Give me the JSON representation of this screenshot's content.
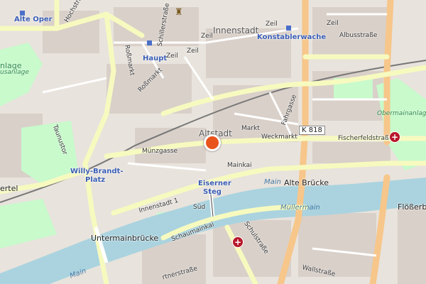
{
  "map": {
    "districts": {
      "innenstadt": "Innenstadt",
      "altstadt": "Altstadt"
    },
    "stations": {
      "alte_oper": "Alte Oper",
      "konstablerwache": "Konstablerwache",
      "haupt": "Haupt",
      "willy_line1": "Willy-Brandt-",
      "willy_line2": "Platz",
      "eiserner_line1": "Eiserner",
      "eiserner_line2": "Steg"
    },
    "streets": {
      "zeil1": "Zeil",
      "zeil2": "Zeil",
      "zeil3": "Zeil",
      "zeil4": "Zeil",
      "zeil5": "Zeil",
      "albusstrasse": "Albusstraße",
      "schillerstrasse": "Schillerstraße",
      "rossmarkt1": "Roßmarkt",
      "rossmarkt2": "Roßmarkt",
      "taunustor": "Taunustor",
      "munzgasse": "Münzgasse",
      "mainkai": "Mainkai",
      "markt": "Markt",
      "weckmarkt": "Weckmarkt",
      "fahrgasse": "Fahrgasse",
      "fischerfeldstrasse": "Fischerfeldstraße",
      "innenstadt_1": "Innenstadt 1",
      "sud": "Süd",
      "schaumainkai": "Schaumainkai",
      "schulstrasse": "Schulstraße",
      "wallstrasse": "Wallstraße",
      "gartnerstrasse": "rtnerstraße",
      "hochstrasse": "Hochstraß",
      "alte_brucke": "Alte Brücke",
      "untermainbrucke": "Untermainbrücke",
      "flossberbrucke": "Flößerbrü",
      "ertel": "ertel",
      "nlage": "nlage",
      "usanlage": "usanlage",
      "obermainanlage": "Obermainanlage"
    },
    "water": {
      "main1": "Main",
      "main2": "Main",
      "mullermain": "Müllermain"
    },
    "road_ref": "K 818",
    "icons": {
      "location_marker": "location-pin-icon",
      "hospital": "hospital-icon",
      "castle": "castle-icon"
    },
    "colors": {
      "water": "#aad3df",
      "park": "#c8facc",
      "built": "#d9d0c9",
      "primary_road": "#f7c68a",
      "secondary_road": "#f7fabf",
      "rail": "#777777",
      "marker": "#e8541c",
      "hospital": "#b8162a"
    }
  }
}
